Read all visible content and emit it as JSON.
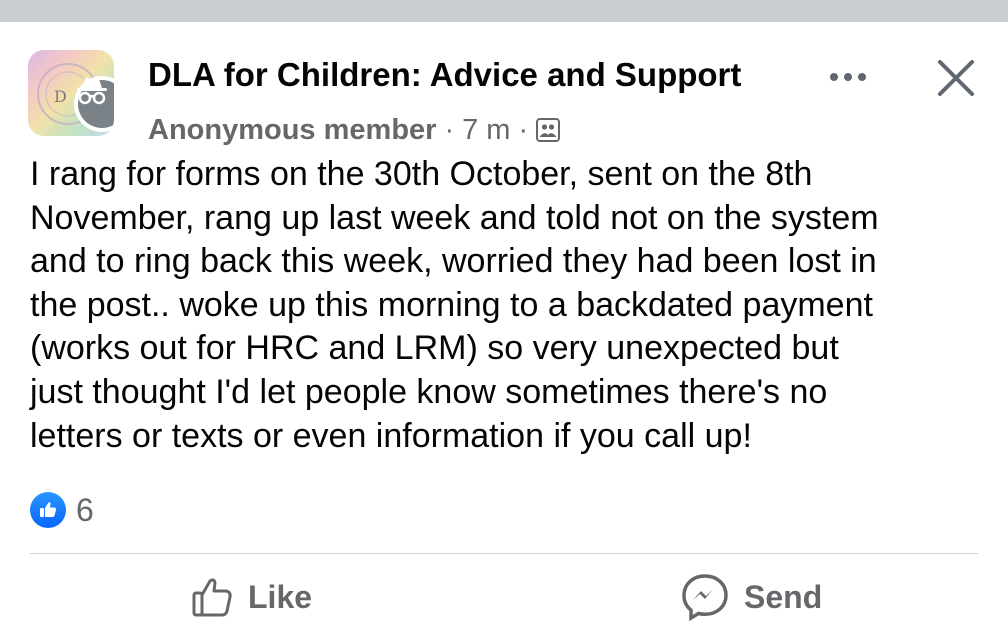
{
  "post": {
    "group_name": "DLA for Children: Advice and Support",
    "author": "Anonymous member",
    "separator": "·",
    "timestamp": "7 m",
    "audience_icon": "group-members-icon",
    "body": "I rang for forms on the 30th October, sent on the 8th\nNovember, rang up last week and told not on the system\nand to ring back this week, worried they had been lost in\nthe post.. woke up this morning to a backdated payment\n(works out for HRC and LRM) so very unexpected but\njust thought I'd let people know sometimes there's no\nletters or texts or even information if you call up!",
    "reactions": {
      "icon": "like-reaction-icon",
      "count": "6"
    }
  },
  "header_actions": {
    "more_icon": "more-options-icon",
    "close_icon": "close-icon"
  },
  "actions": {
    "like_label": "Like",
    "send_label": "Send"
  },
  "colors": {
    "divider": "#c9ccd1",
    "like_blue": "#0866ff",
    "secondary_text": "#65676b",
    "primary_text": "#050505"
  }
}
